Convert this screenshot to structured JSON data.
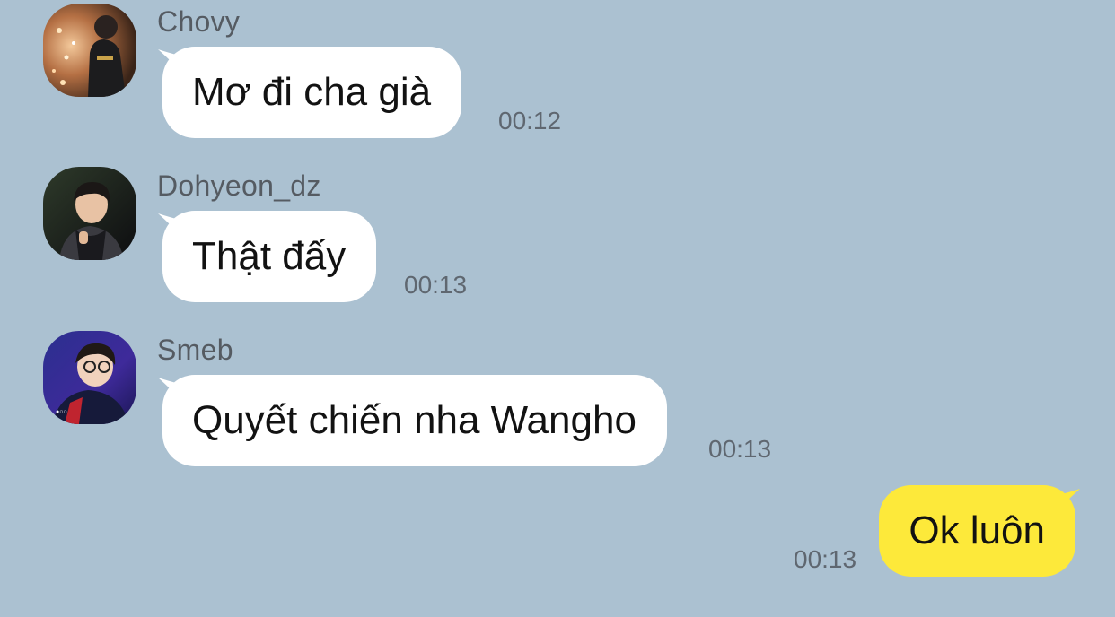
{
  "colors": {
    "background": "#abc1d1",
    "incoming_bubble": "#ffffff",
    "outgoing_bubble": "#fde93a",
    "sender_text": "#555b62",
    "time_text": "#5f6770"
  },
  "messages": [
    {
      "sender": "Chovy",
      "text": "Mơ đi cha già",
      "time": "00:12",
      "avatar": "avatar-photo-chovy"
    },
    {
      "sender": "Dohyeon_dz",
      "text": "Thật đấy",
      "time": "00:13",
      "avatar": "avatar-photo-dohyeon"
    },
    {
      "sender": "Smeb",
      "text": "Quyết chiến nha Wangho",
      "time": "00:13",
      "avatar": "avatar-photo-smeb"
    }
  ],
  "my_message": {
    "text": "Ok luôn",
    "time": "00:13"
  }
}
